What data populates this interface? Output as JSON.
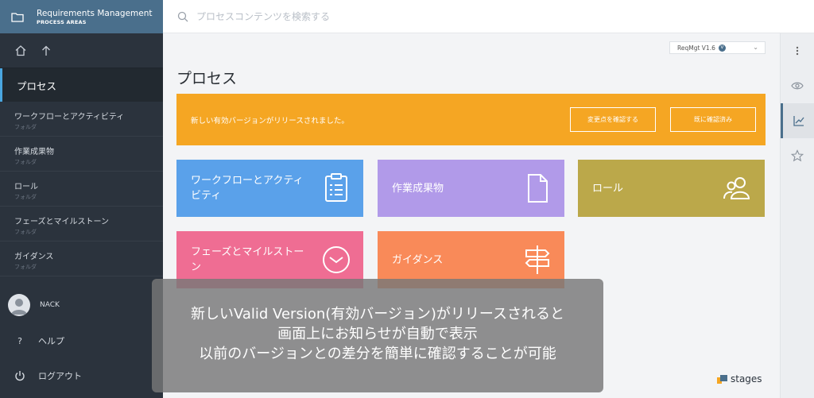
{
  "header": {
    "title": "Requirements Management",
    "subtitle": "PROCESS AREAS"
  },
  "search": {
    "placeholder": "プロセスコンテンツを検索する"
  },
  "sidebar": {
    "active": "プロセス",
    "items": [
      {
        "label": "ワークフローとアクティビティ",
        "sub": "フォルダ"
      },
      {
        "label": "作業成果物",
        "sub": "フォルダ"
      },
      {
        "label": "ロール",
        "sub": "フォルダ"
      },
      {
        "label": "フェーズとマイルストーン",
        "sub": "フォルダ"
      },
      {
        "label": "ガイダンス",
        "sub": "フォルダ"
      }
    ],
    "user": "NACK",
    "help": "ヘルプ",
    "logout": "ログアウト"
  },
  "version": {
    "label": "ReqMgt V1.6",
    "badge": "V"
  },
  "page_title": "プロセス",
  "banner": {
    "message": "新しい有効バージョンがリリースされました。",
    "btn_changes": "変更点を確認する",
    "btn_confirmed": "既に確認済み"
  },
  "tiles": [
    {
      "label": "ワークフローとアクティビティ",
      "color": "#5aa1ea"
    },
    {
      "label": "作業成果物",
      "color": "#b19ae9"
    },
    {
      "label": "ロール",
      "color": "#bba84a"
    },
    {
      "label": "フェーズとマイルストーン",
      "color": "#ef6d93"
    },
    {
      "label": "ガイダンス",
      "color": "#f98a59"
    }
  ],
  "overlay": {
    "line1": "新しいValid Version(有効バージョン)がリリースされると",
    "line2": "画面上にお知らせが自動で表示",
    "line3": "以前のバージョンとの差分を簡単に確認することが可能"
  },
  "logo": "stages",
  "colors": {
    "accent": "#4a6f8c",
    "banner": "#f5a623",
    "sidebar": "#2b333d"
  }
}
